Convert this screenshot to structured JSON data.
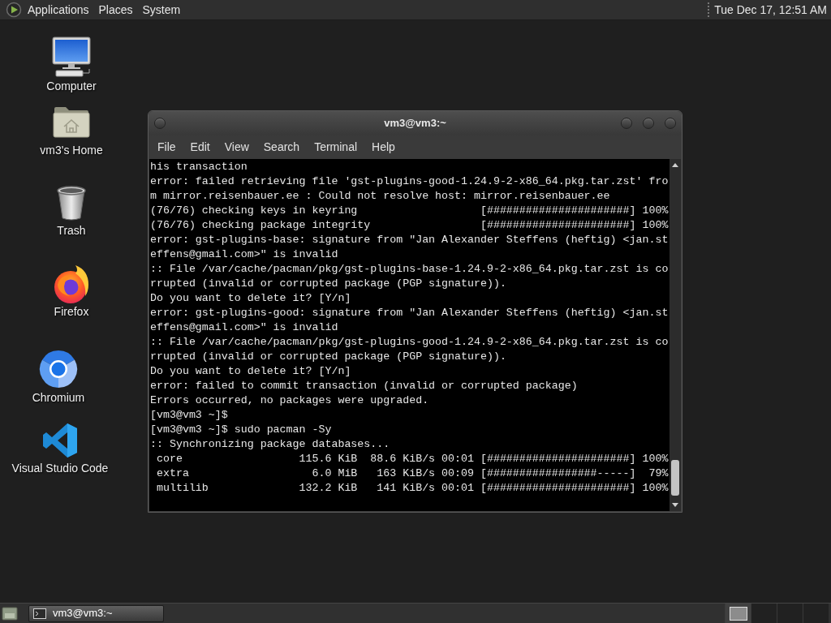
{
  "top_panel": {
    "menus": [
      {
        "label": "Applications"
      },
      {
        "label": "Places"
      },
      {
        "label": "System"
      }
    ],
    "clock": "Tue Dec 17, 12:51 AM"
  },
  "desktop_icons": [
    {
      "label": "Computer",
      "kind": "computer"
    },
    {
      "label": "vm3's Home",
      "kind": "home"
    },
    {
      "label": "Trash",
      "kind": "trash"
    },
    {
      "label": "Firefox",
      "kind": "firefox"
    },
    {
      "label": "Chromium",
      "kind": "chromium"
    },
    {
      "label": "Visual Studio Code",
      "kind": "vscode"
    }
  ],
  "terminal_window": {
    "title": "vm3@vm3:~",
    "menu": [
      "File",
      "Edit",
      "View",
      "Search",
      "Terminal",
      "Help"
    ],
    "lines": [
      "his transaction",
      "error: failed retrieving file 'gst-plugins-good-1.24.9-2-x86_64.pkg.tar.zst' fro",
      "m mirror.reisenbauer.ee : Could not resolve host: mirror.reisenbauer.ee",
      "(76/76) checking keys in keyring                   [######################] 100%",
      "(76/76) checking package integrity                 [######################] 100%",
      "error: gst-plugins-base: signature from \"Jan Alexander Steffens (heftig) <jan.st",
      "effens@gmail.com>\" is invalid",
      ":: File /var/cache/pacman/pkg/gst-plugins-base-1.24.9-2-x86_64.pkg.tar.zst is co",
      "rrupted (invalid or corrupted package (PGP signature)).",
      "Do you want to delete it? [Y/n]",
      "error: gst-plugins-good: signature from \"Jan Alexander Steffens (heftig) <jan.st",
      "effens@gmail.com>\" is invalid",
      ":: File /var/cache/pacman/pkg/gst-plugins-good-1.24.9-2-x86_64.pkg.tar.zst is co",
      "rrupted (invalid or corrupted package (PGP signature)).",
      "Do you want to delete it? [Y/n]",
      "error: failed to commit transaction (invalid or corrupted package)",
      "Errors occurred, no packages were upgraded.",
      "[vm3@vm3 ~]$",
      "[vm3@vm3 ~]$ sudo pacman -Sy",
      ":: Synchronizing package databases...",
      " core                  115.6 KiB  88.6 KiB/s 00:01 [######################] 100%",
      " extra                   6.0 MiB   163 KiB/s 00:09 [#################-----]  79%",
      " multilib              132.2 KiB   141 KiB/s 00:01 [######################] 100%"
    ]
  },
  "bottom_panel": {
    "tasks": [
      {
        "label": "vm3@vm3:~",
        "selected": true
      }
    ],
    "workspaces": [
      {
        "selected": true,
        "has_window": true
      },
      {
        "selected": false,
        "has_window": false
      },
      {
        "selected": false,
        "has_window": false
      },
      {
        "selected": false,
        "has_window": false
      }
    ]
  }
}
